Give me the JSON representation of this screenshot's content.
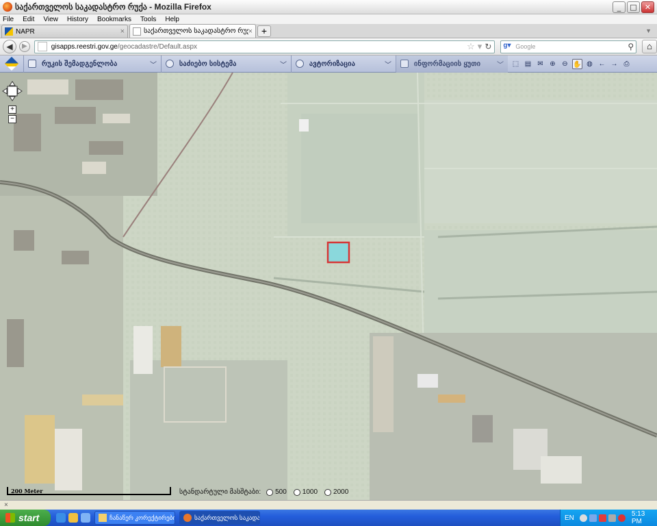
{
  "window": {
    "title": "საქართველოს საკადასტრო რუქა - Mozilla Firefox",
    "buttons": {
      "minimize": "_",
      "maximize": "□",
      "close": "✕"
    }
  },
  "menu": [
    "File",
    "Edit",
    "View",
    "History",
    "Bookmarks",
    "Tools",
    "Help"
  ],
  "tabs": [
    {
      "label": "NAPR",
      "active": false
    },
    {
      "label": "საქართველოს საკადასტრო რუქა",
      "active": true
    }
  ],
  "nav": {
    "url_host": "gisapps.reestri.gov.ge",
    "url_path": "/geocadastre/Default.aspx",
    "search_placeholder": "Google",
    "search_engine_icon": "google-icon"
  },
  "app_toolbar": {
    "dropdowns": [
      {
        "label": "რუკის შემადგენლობა",
        "icon": "layers-icon"
      },
      {
        "label": "საძიებო სისტემა",
        "icon": "search-icon"
      },
      {
        "label": "ავტორიზაცია",
        "icon": "user-icon"
      },
      {
        "label": "ინფორმაციის ყუთი",
        "icon": "info-box-icon"
      }
    ],
    "tools": [
      "zoom-box-icon",
      "document-icon",
      "envelope-icon",
      "zoom-in-icon",
      "zoom-out-icon",
      "pan-hand-icon",
      "globe-icon",
      "back-arrow-icon",
      "forward-arrow-icon",
      "print-icon"
    ]
  },
  "map": {
    "scale_text": "200 Meter",
    "scale_label": "სტანდარტული მასშტაბი:",
    "scale_options": [
      "500",
      "1000",
      "2000"
    ],
    "highlight_color": "#d11a1a",
    "parcel_fill": "#7ad3d8",
    "zoom_in": "+",
    "zoom_out": "−"
  },
  "findbar": {
    "close": "×"
  },
  "taskbar": {
    "start": "start",
    "items": [
      {
        "label": "ჩანაწერ კორექტირების სერვ...",
        "active": false
      },
      {
        "label": "საქართველოს საკადას...",
        "active": true
      }
    ],
    "lang": "EN",
    "time": "5:13 PM"
  }
}
